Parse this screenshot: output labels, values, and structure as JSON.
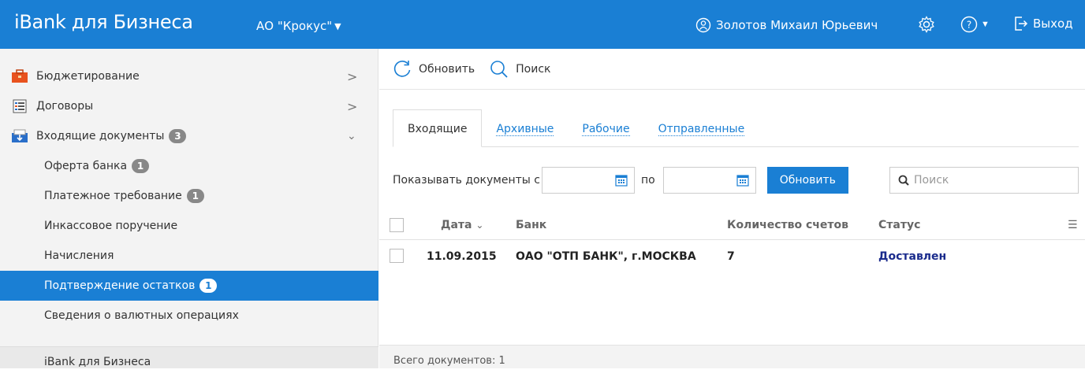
{
  "header": {
    "app_title": "iBank для Бизнеса",
    "organization": "АО \"Крокус\"",
    "user_name": "Золотов Михаил Юрьевич",
    "logout_label": "Выход",
    "accent": "#1a7fd4"
  },
  "sidebar": {
    "items": [
      {
        "label": "Бюджетирование",
        "icon": "briefcase-icon"
      },
      {
        "label": "Договоры",
        "icon": "document-list-icon"
      },
      {
        "label": "Входящие документы",
        "icon": "inbox-icon",
        "badge": "3"
      },
      {
        "label": "Оферта банка",
        "badge": "1"
      },
      {
        "label": "Платежное требование",
        "badge": "1"
      },
      {
        "label": "Инкассовое поручение"
      },
      {
        "label": "Начисления"
      },
      {
        "label": "Подтверждение остатков",
        "badge": "1",
        "active": true
      },
      {
        "label": "Сведения о валютных операциях"
      }
    ],
    "footer": "iBank для Бизнеса"
  },
  "toolbar": {
    "refresh_label": "Обновить",
    "search_label": "Поиск"
  },
  "tabs": [
    {
      "label": "Входящие",
      "active": true
    },
    {
      "label": "Архивные"
    },
    {
      "label": "Рабочие"
    },
    {
      "label": "Отправленные"
    }
  ],
  "filter": {
    "show_from_label": "Показывать документы с",
    "to_label": "по",
    "date_from": "",
    "date_to": "",
    "refresh_button": "Обновить",
    "search_placeholder": "Поиск"
  },
  "table": {
    "columns": [
      "Дата",
      "Банк",
      "Количество счетов",
      "Статус"
    ],
    "rows": [
      {
        "date": "11.09.2015",
        "bank": "ОАО \"ОТП БАНК\", г.МОСКВА",
        "accounts": "7",
        "status": "Доставлен"
      }
    ]
  },
  "footer": {
    "total_label": "Всего документов: 1"
  }
}
